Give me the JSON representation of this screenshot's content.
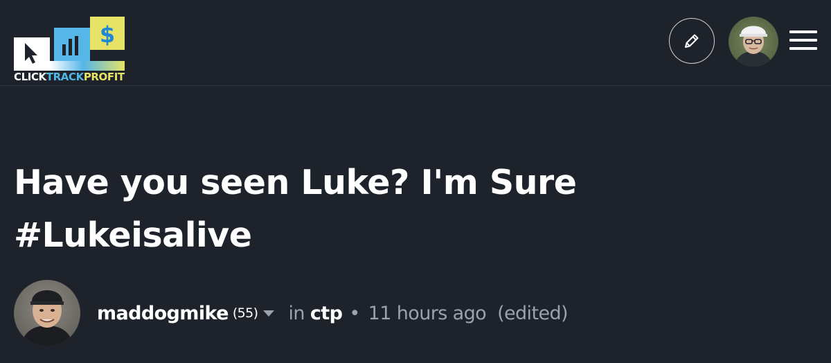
{
  "header": {
    "logo": {
      "word_click": "CLICK",
      "word_track": "TRACK",
      "word_profit": "PROFIT",
      "symbol": "$",
      "colors": [
        "#ffffff",
        "#4fb6e6",
        "#e6e366"
      ]
    },
    "edit_icon": "pencil-icon",
    "menu_icon": "hamburger-menu-icon"
  },
  "post": {
    "title": "Have you seen Luke? I'm Sure #Lukeisalive",
    "author": "maddogmike",
    "reputation": "(55)",
    "in_label": "in",
    "community": "ctp",
    "separator": "•",
    "time_ago": "11 hours ago",
    "edited": "(edited)"
  },
  "colors": {
    "background": "#1e232b",
    "muted_text": "#9aa2ad",
    "title_text": "#ffffff"
  }
}
